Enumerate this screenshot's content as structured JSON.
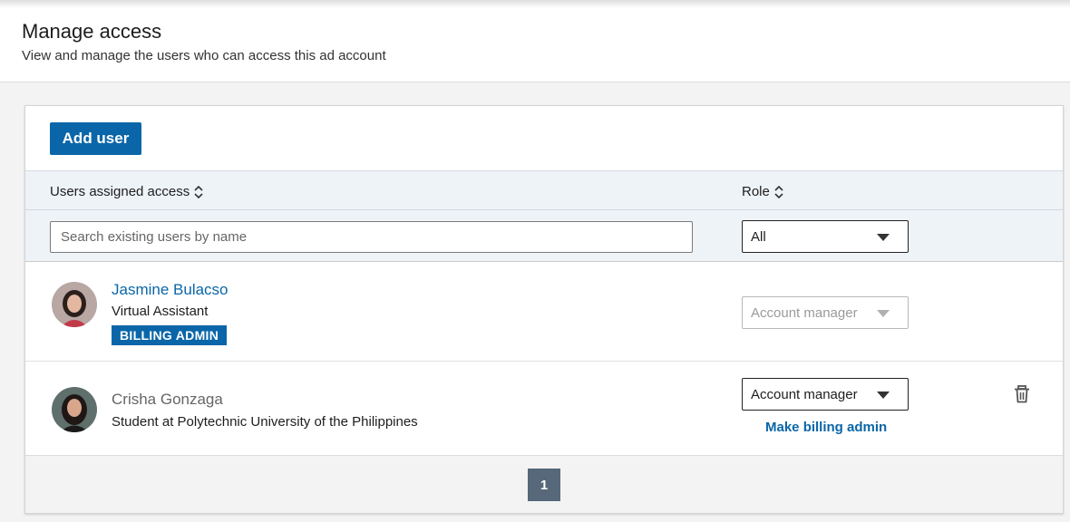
{
  "header": {
    "title": "Manage access",
    "subtitle": "View and manage the users who can access this ad account"
  },
  "toolbar": {
    "add_user_label": "Add user"
  },
  "table": {
    "col_users": "Users assigned access",
    "col_role": "Role",
    "search_placeholder": "Search existing users by name",
    "role_filter": "All"
  },
  "users": [
    {
      "name": "Jasmine Bulacso",
      "title": "Virtual Assistant",
      "badge": "BILLING ADMIN",
      "role": "Account manager"
    },
    {
      "name": "Crisha Gonzaga",
      "title": "Student at Polytechnic University of the Philippines",
      "role": "Account manager",
      "action": "Make billing admin"
    }
  ],
  "pagination": {
    "current": "1"
  },
  "colors": {
    "accent": "#0a66a8",
    "header_bg": "#eef3f8",
    "pager_active": "#56687a"
  }
}
